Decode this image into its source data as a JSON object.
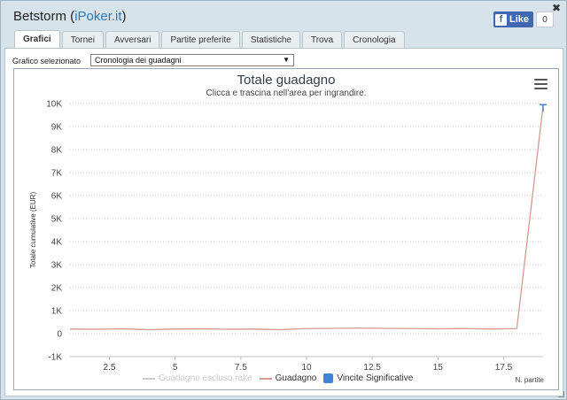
{
  "window": {
    "title_prefix": "Betstorm (",
    "title_link": "iPoker.it",
    "title_suffix": ")",
    "close_glyph": "✖"
  },
  "facebook": {
    "like_label": "Like",
    "count": "0",
    "icon_glyph": "f"
  },
  "tabs": [
    {
      "label": "Grafici",
      "active": true
    },
    {
      "label": "Tornei",
      "active": false
    },
    {
      "label": "Avversari",
      "active": false
    },
    {
      "label": "Partite preferite",
      "active": false
    },
    {
      "label": "Statistiche",
      "active": false
    },
    {
      "label": "Trova",
      "active": false
    },
    {
      "label": "Cronologia",
      "active": false
    }
  ],
  "selector": {
    "label": "Grafico selezionato",
    "value": "Cronologia dei guadagni",
    "arrow": "▼"
  },
  "chart_data": {
    "type": "line",
    "title": "Totale guadagno",
    "subtitle": "Clicca e trascina nell'area per ingrandire.",
    "ylabel": "Totale cumulative (EUR)",
    "xlabel": "N. partite",
    "ylim": [
      -1000,
      10000
    ],
    "xlim": [
      1,
      19
    ],
    "y_ticks": [
      {
        "v": 10000,
        "label": "10K"
      },
      {
        "v": 9000,
        "label": "9K"
      },
      {
        "v": 8000,
        "label": "8K"
      },
      {
        "v": 7000,
        "label": "7K"
      },
      {
        "v": 6000,
        "label": "6K"
      },
      {
        "v": 5000,
        "label": "5K"
      },
      {
        "v": 4000,
        "label": "4K"
      },
      {
        "v": 3000,
        "label": "3K"
      },
      {
        "v": 2000,
        "label": "2K"
      },
      {
        "v": 1000,
        "label": "1K"
      },
      {
        "v": 0,
        "label": "0"
      },
      {
        "v": -1000,
        "label": "-1K"
      }
    ],
    "x_ticks": [
      {
        "v": 2.5,
        "label": "2.5"
      },
      {
        "v": 5,
        "label": "5"
      },
      {
        "v": 7.5,
        "label": "7.5"
      },
      {
        "v": 10,
        "label": "10"
      },
      {
        "v": 12.5,
        "label": "12.5"
      },
      {
        "v": 15,
        "label": "15"
      },
      {
        "v": 17.5,
        "label": "17.5"
      }
    ],
    "grid": true,
    "legend_position": "bottom",
    "series": [
      {
        "name": "Guadagno escluso rake",
        "visible": false,
        "color": "#cccccc",
        "kind": "line",
        "x": [],
        "y": []
      },
      {
        "name": "Guadagno",
        "visible": true,
        "color": "#d49a8e",
        "kind": "line",
        "x": [
          1,
          2,
          3,
          4,
          5,
          6,
          7,
          8,
          9,
          10,
          11,
          12,
          13,
          14,
          15,
          16,
          17,
          18,
          19
        ],
        "y": [
          200,
          190,
          210,
          170,
          200,
          210,
          190,
          200,
          170,
          220,
          230,
          240,
          230,
          220,
          210,
          220,
          200,
          220,
          9900
        ]
      },
      {
        "name": "Vincite Significative",
        "visible": true,
        "color": "#3d85d6",
        "kind": "marker",
        "x": [
          19
        ],
        "y": [
          9950
        ]
      }
    ]
  }
}
